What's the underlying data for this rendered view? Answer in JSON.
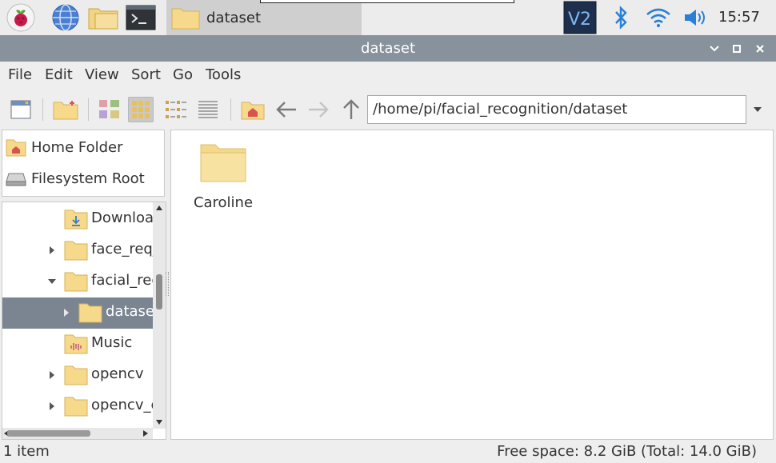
{
  "taskbar": {
    "icons": [
      "raspberry-menu-icon",
      "web-browser-icon",
      "file-manager-icon",
      "terminal-icon"
    ],
    "task_label": "dataset",
    "tray": [
      "vnc-icon",
      "bluetooth-icon",
      "wifi-icon",
      "volume-icon"
    ],
    "clock": "15:57"
  },
  "window": {
    "title": "dataset",
    "controls": [
      "minimize-icon",
      "maximize-icon",
      "close-icon"
    ]
  },
  "menu": [
    "File",
    "Edit",
    "View",
    "Sort",
    "Go",
    "Tools"
  ],
  "toolbar": {
    "path": "/home/pi/facial_recognition/dataset",
    "active_view": "icon-view"
  },
  "places": [
    {
      "label": "Home Folder",
      "icon": "home-folder-icon"
    },
    {
      "label": "Filesystem Root",
      "icon": "drive-icon"
    }
  ],
  "tree": [
    {
      "label": "Downloa",
      "icon": "downloads-folder-icon",
      "toggle": "none",
      "selected": false
    },
    {
      "label": "face_req_",
      "icon": "folder-icon",
      "toggle": "collapsed",
      "selected": false
    },
    {
      "label": "facial_rec",
      "icon": "folder-icon",
      "toggle": "expanded",
      "selected": false
    },
    {
      "label": "datase",
      "icon": "folder-icon",
      "toggle": "collapsed",
      "selected": true
    },
    {
      "label": "Music",
      "icon": "music-folder-icon",
      "toggle": "none",
      "selected": false
    },
    {
      "label": "opencv",
      "icon": "folder-icon",
      "toggle": "collapsed",
      "selected": false
    },
    {
      "label": "opencv_c",
      "icon": "folder-icon",
      "toggle": "collapsed",
      "selected": false
    }
  ],
  "files": [
    {
      "label": "Caroline",
      "icon": "folder-icon"
    }
  ],
  "status": {
    "count": "1 item",
    "free_space": "Free space: 8.2 GiB (Total: 14.0 GiB)"
  },
  "colors": {
    "titlebar": "#87929c",
    "selection": "#7a8591",
    "folder": "#f6d98b"
  }
}
